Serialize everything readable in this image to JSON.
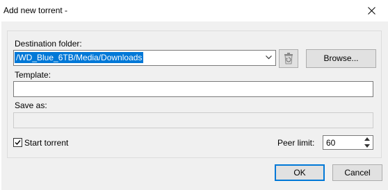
{
  "window": {
    "title": "Add new torrent -",
    "close_icon": "close-icon"
  },
  "destination": {
    "label": "Destination folder:",
    "value": "/WD_Blue_6TB/Media/Downloads",
    "dropdown_icon": "chevron-down-icon",
    "recycle_icon": "recycle-bin-icon",
    "browse_label": "Browse..."
  },
  "template": {
    "label": "Template:",
    "value": ""
  },
  "save_as": {
    "label": "Save as:",
    "value": ""
  },
  "start_torrent": {
    "label": "Start torrent",
    "checked": true
  },
  "peer_limit": {
    "label": "Peer limit:",
    "value": "60"
  },
  "buttons": {
    "ok_label": "OK",
    "cancel_label": "Cancel"
  },
  "colors": {
    "selection": "#0078d7",
    "default_button_border": "#0078d7",
    "dialog_background": "#f0f0f0"
  }
}
